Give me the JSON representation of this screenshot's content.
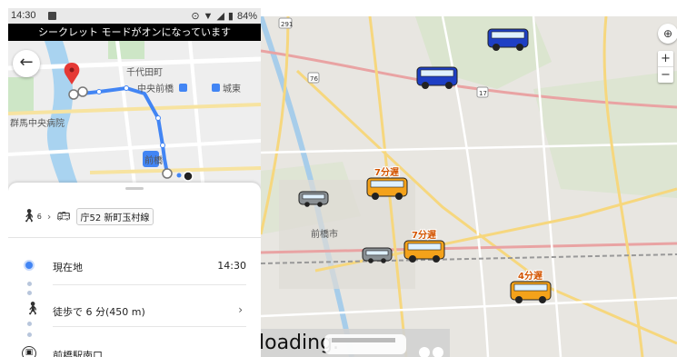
{
  "status_bar": {
    "time": "14:30",
    "battery": "84%"
  },
  "incognito_banner": "シークレット モードがオンになっています",
  "minimap": {
    "labels": {
      "town": "千代田町",
      "station_chuo": "中央前橋",
      "castle_east": "城東",
      "hospital": "群馬中央病院",
      "station_maebashi": "前橋"
    }
  },
  "route": {
    "walk_sub": "6",
    "route_name": "庁52 新町玉村線",
    "steps": {
      "current": {
        "label": "現在地",
        "time": "14:30"
      },
      "walk": {
        "label": "徒歩で 6 分(450 m)"
      },
      "stop": {
        "label": "前橋駅南口"
      }
    }
  },
  "bigmap": {
    "labels": {
      "city": "前橋市",
      "road_17": "17",
      "road_76": "76",
      "road_291": "291"
    },
    "buses": [
      {
        "color": "blue",
        "delay": ""
      },
      {
        "color": "blue",
        "delay": ""
      },
      {
        "color": "orange",
        "delay": "7分遅"
      },
      {
        "color": "orange",
        "delay": "7分遅"
      },
      {
        "color": "orange",
        "delay": "4分遅"
      },
      {
        "color": "gray",
        "delay": ""
      },
      {
        "color": "gray",
        "delay": ""
      }
    ],
    "zoom_in": "+",
    "zoom_out": "−"
  },
  "loading_text": "loading.",
  "colors": {
    "route_blue": "#4285f4",
    "bus_blue": "#1e3fc4",
    "bus_orange": "#f4a21a",
    "bus_gray": "#8a9094",
    "map_bg": "#e8e6e1",
    "road_yellow": "#f6d77e",
    "road_orange": "#e9a3a3"
  }
}
